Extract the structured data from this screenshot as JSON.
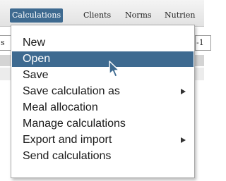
{
  "menubar": {
    "items": [
      {
        "label": "Calculations",
        "active": true
      },
      {
        "label": "Clients",
        "active": false
      },
      {
        "label": "Norms",
        "active": false
      },
      {
        "label": "Nutrien",
        "active": false
      }
    ]
  },
  "background": {
    "left_field_text": "s",
    "right_field_text": "-1"
  },
  "dropdown": {
    "items": [
      {
        "label": "New",
        "selected": false,
        "has_submenu": false
      },
      {
        "label": "Open",
        "selected": true,
        "has_submenu": false
      },
      {
        "label": "Save",
        "selected": false,
        "has_submenu": false
      },
      {
        "label": "Save calculation as",
        "selected": false,
        "has_submenu": true
      },
      {
        "label": "Meal allocation",
        "selected": false,
        "has_submenu": false
      },
      {
        "label": "Manage calculations",
        "selected": false,
        "has_submenu": false
      },
      {
        "label": "Export and import",
        "selected": false,
        "has_submenu": true
      },
      {
        "label": "Send calculations",
        "selected": false,
        "has_submenu": false
      }
    ]
  },
  "colors": {
    "selection": "#3e6a90",
    "menu_background": "#ffffff",
    "text": "#1a1a1a"
  },
  "icons": {
    "cursor": "mouse-pointer-icon",
    "submenu": "submenu-arrow-icon"
  }
}
